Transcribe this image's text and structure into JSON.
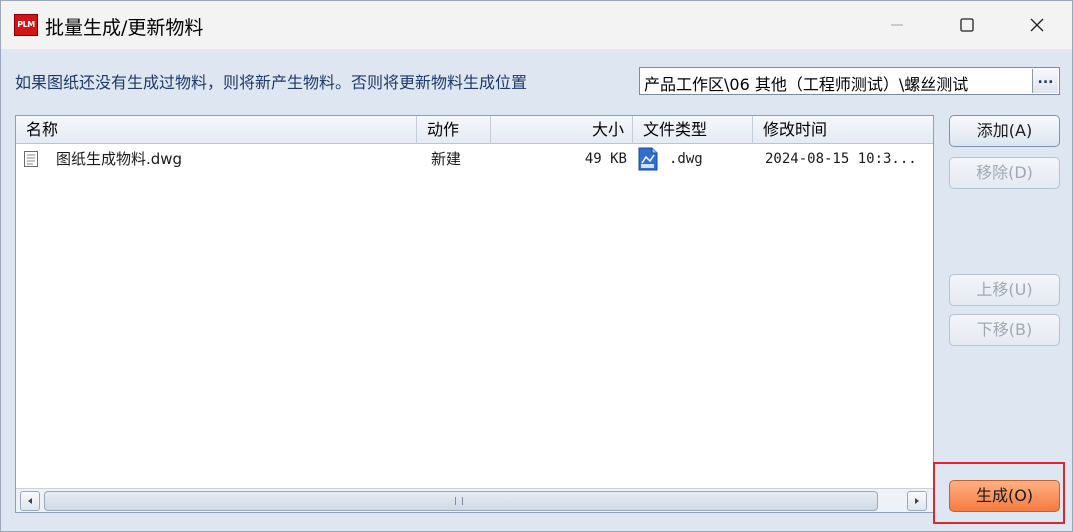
{
  "window": {
    "app_icon_text": "PLM",
    "title": "批量生成/更新物料",
    "minimize_icon": "minimize-icon",
    "maximize_icon": "maximize-icon",
    "close_icon": "close-icon"
  },
  "location": {
    "label": "如果图纸还没有生成过物料，则将新产生物料。否则将更新物料生成位置",
    "value": "产品工作区\\06 其他（工程师测试）\\螺丝测试",
    "browse_label": "..."
  },
  "table": {
    "columns": [
      "名称",
      "动作",
      "大小",
      "文件类型",
      "修改时间"
    ],
    "rows": [
      {
        "name": "图纸生成物料.dwg",
        "action": "新建",
        "size": "49 KB",
        "type": ".dwg",
        "modified": "2024-08-15 10:3..."
      }
    ]
  },
  "buttons": {
    "add": "添加(A)",
    "remove": "移除(D)",
    "up": "上移(U)",
    "down": "下移(B)",
    "generate": "生成(O)"
  },
  "colors": {
    "accent": "#f47a3e",
    "highlight_border": "#e0262c",
    "app_icon": "#d41414"
  }
}
